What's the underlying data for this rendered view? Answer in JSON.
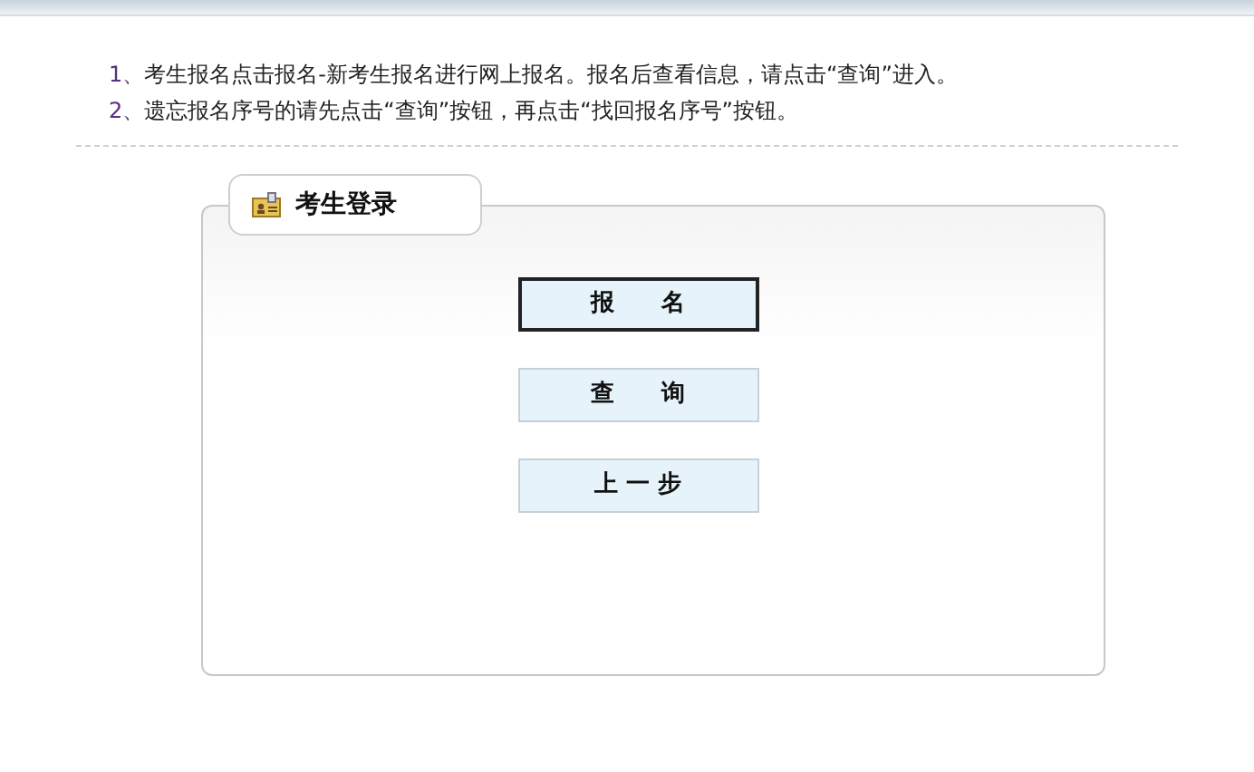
{
  "instructions": [
    {
      "number": "1、",
      "text": "考生报名点击报名-新考生报名进行网上报名。报名后查看信息，请点击“查询”进入。"
    },
    {
      "number": "2、",
      "text": "遗忘报名序号的请先点击“查询”按钮，再点击“找回报名序号”按钮。"
    }
  ],
  "panel": {
    "title": "考生登录",
    "buttons": [
      {
        "label": "报　　名",
        "selected": true
      },
      {
        "label": "查　　询",
        "selected": false
      },
      {
        "label": "上 一 步",
        "selected": false
      }
    ]
  }
}
